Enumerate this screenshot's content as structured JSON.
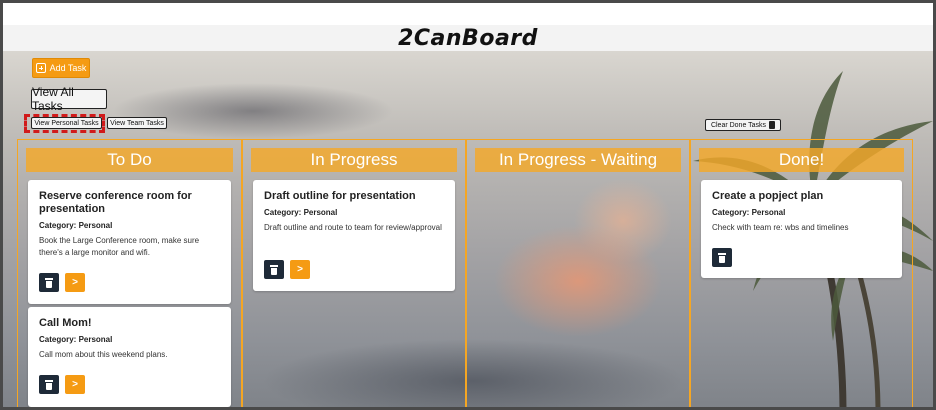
{
  "app": {
    "logo": "2CanBoard"
  },
  "toolbar": {
    "add_task": "Add Task",
    "view_all": "View All Tasks",
    "view_personal": "View Personal Tasks",
    "view_team": "View Team Tasks",
    "clear_done": "Clear Done Tasks"
  },
  "columns": [
    {
      "title": "To Do",
      "cards": [
        {
          "title": "Reserve conference room for presentation",
          "category": "Category: Personal",
          "description": "Book the Large Conference room, make sure there's a large monitor and wifi.",
          "move_glyph": ">"
        },
        {
          "title": "Call Mom!",
          "category": "Category: Personal",
          "description": "Call mom about this weekend plans.",
          "move_glyph": ">"
        }
      ]
    },
    {
      "title": "In Progress",
      "cards": [
        {
          "title": "Draft outline for presentation",
          "category": "Category: Personal",
          "description": "Draft outline and route to team for review/approval",
          "move_glyph": ">"
        }
      ]
    },
    {
      "title": "In Progress - Waiting",
      "cards": []
    },
    {
      "title": "Done!",
      "cards": [
        {
          "title": "Create a popject plan",
          "category": "Category: Personal",
          "description": "Check with team re: wbs and timelines"
        }
      ]
    }
  ],
  "colors": {
    "accent_orange": "#f59b13",
    "column_border": "#f5a623",
    "delete_button": "#1e2a38",
    "highlight_dashed": "#d11a1a"
  },
  "icons": [
    "plus-icon",
    "trash-icon",
    "chevron-right-icon"
  ]
}
